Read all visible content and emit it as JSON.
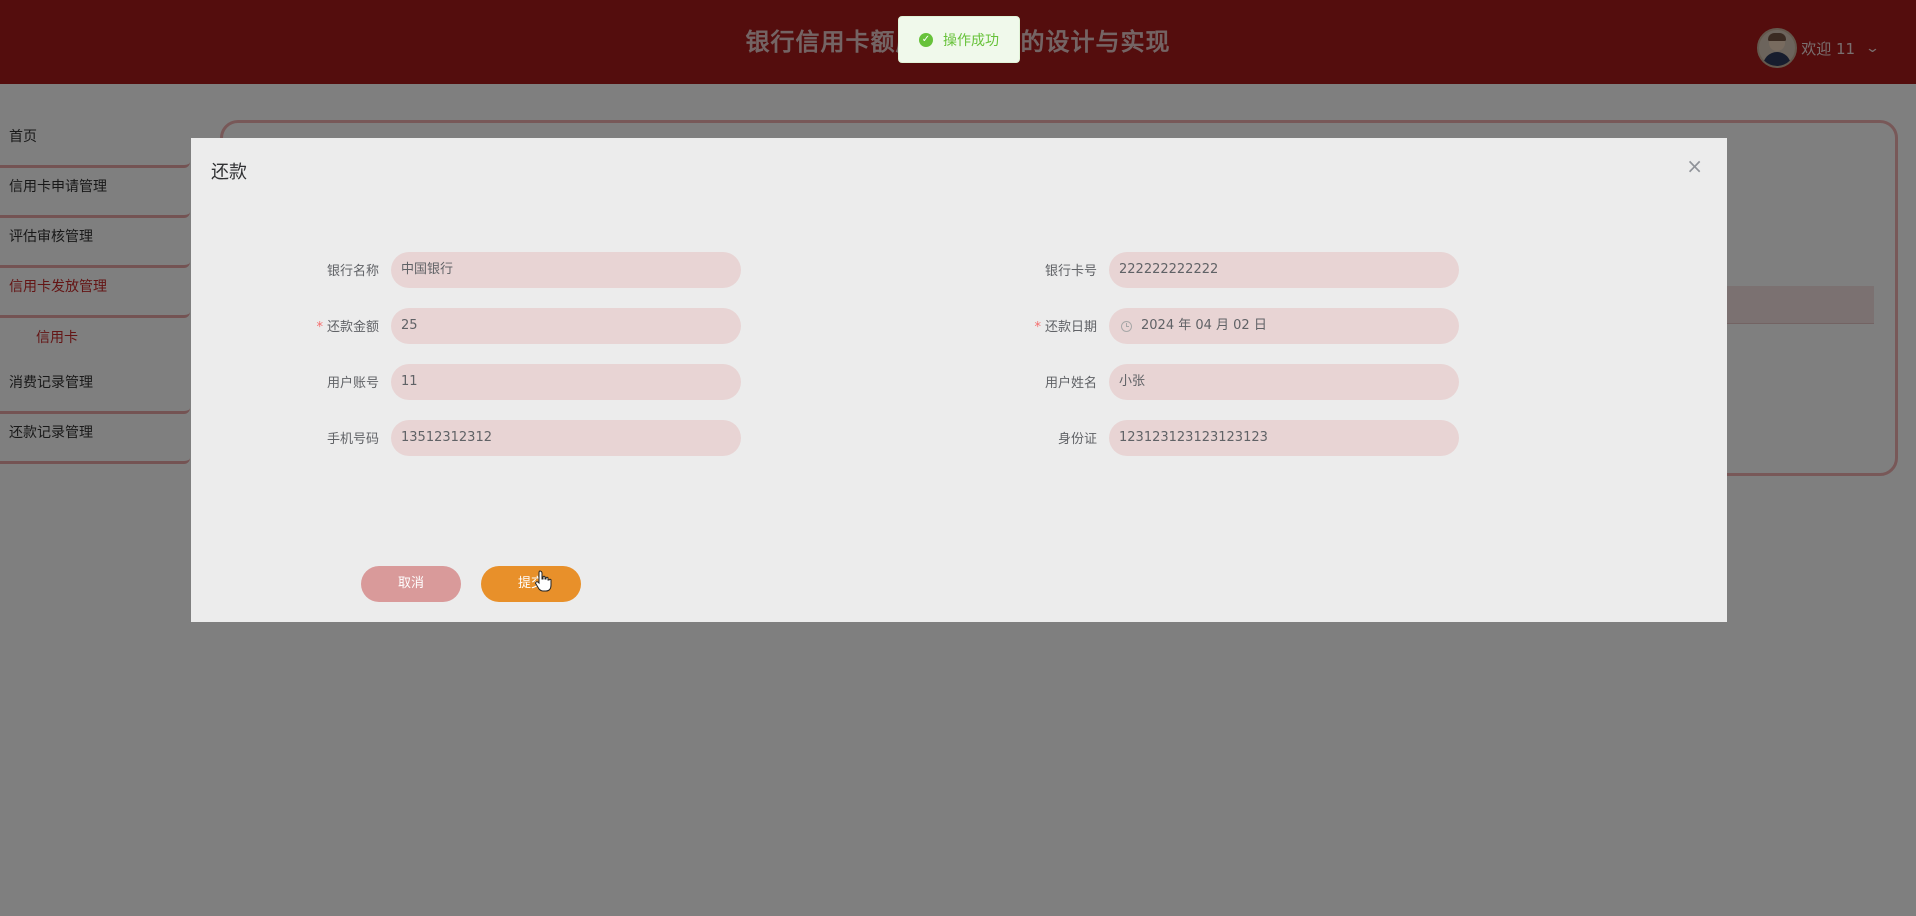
{
  "header": {
    "title": "银行信用卡额度管理系统的设计与实现",
    "welcome": "欢迎 11"
  },
  "toast": {
    "message": "操作成功"
  },
  "sidebar": {
    "items": [
      {
        "label": "首页"
      },
      {
        "label": "信用卡申请管理"
      },
      {
        "label": "评估审核管理"
      },
      {
        "label": "信用卡发放管理"
      },
      {
        "label": "信用卡"
      },
      {
        "label": "消费记录管理"
      },
      {
        "label": "还款记录管理"
      }
    ]
  },
  "dialog": {
    "title": "还款",
    "close": "×",
    "fields": {
      "bank_name": {
        "label": "银行名称",
        "value": "中国银行"
      },
      "card_no": {
        "label": "银行卡号",
        "value": "222222222222"
      },
      "amount": {
        "label": "还款金额",
        "value": "25",
        "required": "*"
      },
      "date": {
        "label": "还款日期",
        "value": "2024 年 04 月 02 日",
        "required": "*"
      },
      "account": {
        "label": "用户账号",
        "value": "11"
      },
      "name": {
        "label": "用户姓名",
        "value": "小张"
      },
      "phone": {
        "label": "手机号码",
        "value": "13512312312"
      },
      "id_card": {
        "label": "身份证",
        "value": "123123123123123123"
      }
    },
    "buttons": {
      "cancel": "取消",
      "submit": "提交"
    }
  },
  "colors": {
    "header": "#a81b1b",
    "accent": "#c82b2b",
    "input_bg": "#e8d4d4",
    "submit": "#e8902a",
    "cancel": "#d99a9a",
    "success": "#67c23a"
  }
}
